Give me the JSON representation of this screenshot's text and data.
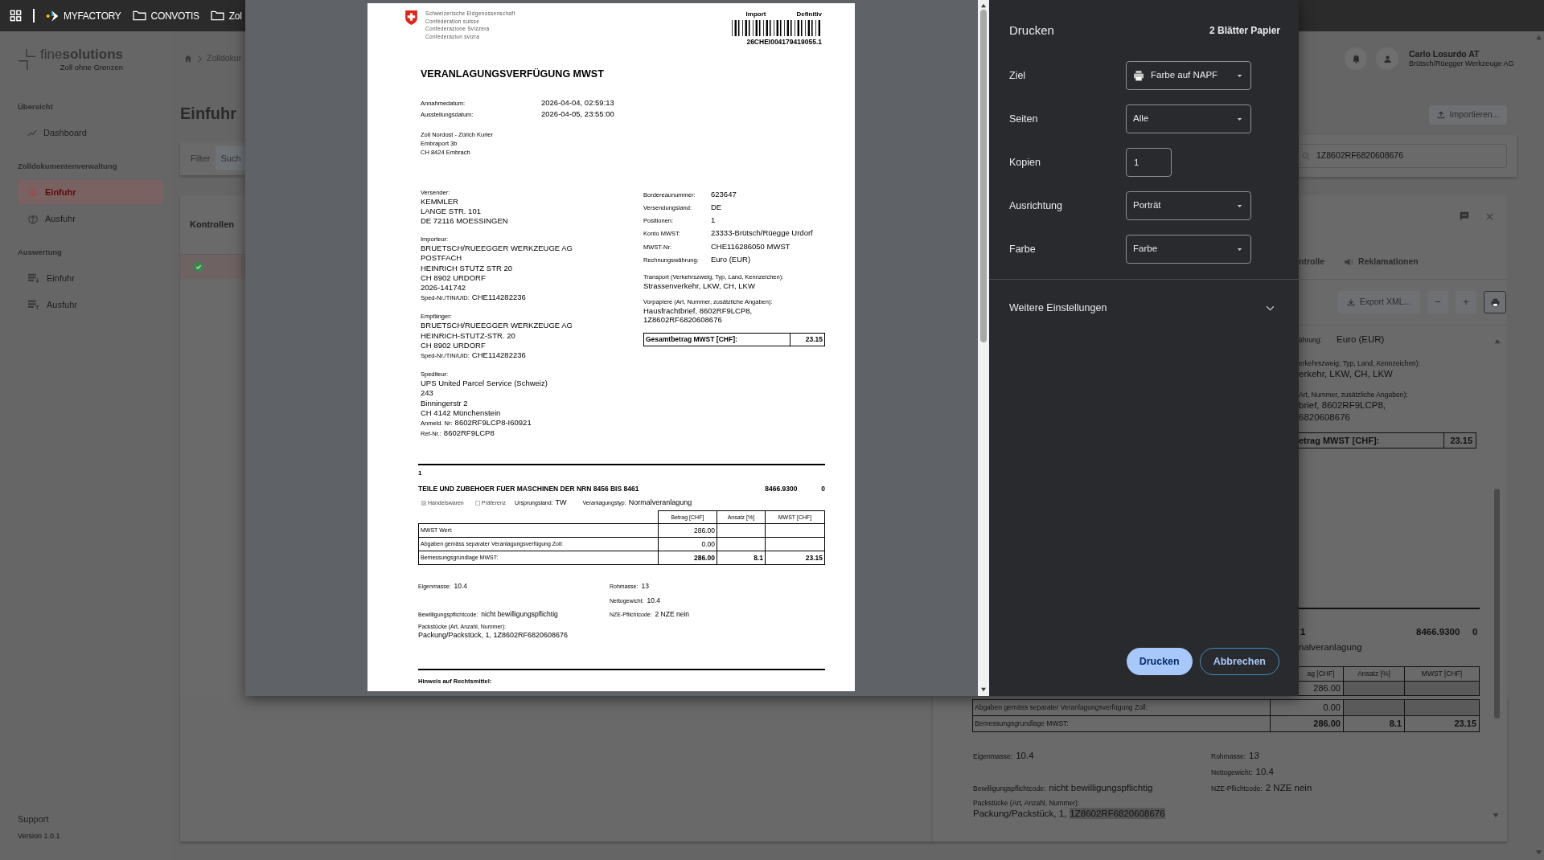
{
  "top_bar": {
    "items": [
      {
        "kind": "apps"
      },
      {
        "kind": "brand",
        "label": "MYFACTORY"
      },
      {
        "kind": "folder",
        "label": "CONVOTIS"
      },
      {
        "kind": "folder",
        "label": "Zol"
      }
    ]
  },
  "sidebar": {
    "logo": {
      "name": "fine**solutions**",
      "tagline": "Zoll ohne Grenzen"
    },
    "sections": [
      {
        "title": "Übersicht",
        "items": [
          {
            "label": "Dashboard",
            "selected": false
          }
        ]
      },
      {
        "title": "Zolldokumentenverwaltung",
        "items": [
          {
            "label": "Einfuhr",
            "selected": true
          },
          {
            "label": "Ausfuhr",
            "selected": false
          }
        ]
      },
      {
        "title": "Auswertung",
        "items": [
          {
            "label": "Einfuhr",
            "selected": false
          },
          {
            "label": "Ausfuhr",
            "selected": false
          }
        ]
      }
    ],
    "support": "Support",
    "version": "Version 1.0.1"
  },
  "main": {
    "breadcrumb": "Zolldokur",
    "title": "Einfuhr",
    "filter_tabs": [
      {
        "label": "Filter",
        "selected": false
      },
      {
        "label": "Such",
        "selected": true
      }
    ],
    "results_header": "Kontrollen"
  },
  "user": {
    "name": "Carlo Losurdo AT",
    "company": "Brütsch/Rüegger Werkzeuge AG"
  },
  "import_button": "Importieren...",
  "search": {
    "value": "1Z8602RF6820608676"
  },
  "detail": {
    "tabs": [
      {
        "label": "ntrolle"
      },
      {
        "label": "Reklamationen"
      }
    ],
    "toolbar": [
      {
        "kind": "export",
        "label": "Export XML...",
        "selected": false
      },
      {
        "kind": "zoom_out",
        "label": "−",
        "selected": false
      },
      {
        "kind": "zoom_in",
        "label": "+",
        "selected": false
      },
      {
        "kind": "print",
        "selected": true
      }
    ],
    "document_top": {
      "currency_label": "ährung:",
      "currency": "Euro (EUR)",
      "transport_label": "erkehrszweig, Typ, Land, Kennzeichen):",
      "transport": "erkehr, LKW, CH, LKW",
      "prior_label": "Art, Nummer, zusätzliche Angaben):",
      "prior_lines": [
        "brief, 8602RF9LCP8,",
        "6820608676"
      ],
      "total_label": "etrag MWST [CHF]:",
      "total": "23.15"
    },
    "item": {
      "number": "1",
      "tariff": "8466.9300",
      "column_3": "0",
      "assessment": "nalveranlagung",
      "columns": [
        "ag [CHF]",
        "Ansatz [%]",
        "MWST [CHF]"
      ],
      "rows": [
        {
          "kind": "plain",
          "amount": "286.00"
        },
        {
          "kind": "plain",
          "label": "Abgaben gemäss separater Veranlagungsverfügung Zoll:",
          "amount": "0.00"
        },
        {
          "kind": "total",
          "label": "Bemessungsgrundlage MWST:",
          "amount": "286.00",
          "rate": "8.1",
          "vat": "23.15"
        }
      ],
      "detail_rows": [
        {
          "left": {
            "label": "Eigenmasse:",
            "value": "10.4"
          },
          "right": {
            "label": "Rohmasse:",
            "value": "13"
          }
        },
        {
          "right": {
            "label": "Nettogewicht:",
            "value": "10.4"
          }
        },
        {
          "left": {
            "label": "Bewilligungspflichtcode:",
            "value": "nicht bewilligungspflichtig"
          },
          "right": {
            "label": "NZE-Pflichtcode:",
            "value": "2 NZE nein"
          }
        }
      ],
      "packages": {
        "label": "Packstücke (Art, Anzahl, Nummer):",
        "value": "Packung/Packstück, 1,",
        "highlighted": "1Z8602RF6820608676"
      }
    }
  },
  "print_dialog": {
    "title": "Drucken",
    "sheets": "2 Blätter Papier",
    "fields": [
      {
        "label": "Ziel",
        "kind": "select",
        "value": "Farbe auf NAPF"
      },
      {
        "label": "Seiten",
        "kind": "select",
        "value": "Alle"
      },
      {
        "label": "Kopien",
        "kind": "number",
        "value": "1"
      },
      {
        "label": "Ausrichtung",
        "kind": "select",
        "value": "Porträt"
      },
      {
        "label": "Farbe",
        "kind": "select",
        "value": "Farbe"
      }
    ],
    "more": "Weitere Einstellungen",
    "buttons": [
      {
        "label": "Drucken",
        "kind": "primary"
      },
      {
        "label": "Abbrechen",
        "kind": "secondary"
      }
    ]
  },
  "preview_page": {
    "authority": [
      "Schweizerische Eidgenossenschaft",
      "Confédération suisse",
      "Confederazione Svizzera",
      "Confederaziun svizra"
    ],
    "flow": "Import",
    "status": "Definitiv",
    "barcode_number": "26CHEI004179419055.1",
    "title": "VERANLAGUNGSVERFÜGUNG MWST",
    "dates": [
      {
        "label": "Annahmedatum:",
        "value": "2026-04-04, 02:59:13"
      },
      {
        "label": "Ausstellungsdatum:",
        "value": "2026-04-05, 23:55:00"
      }
    ],
    "office": [
      "Zoll Nordost - Zürich Kurier",
      "Embraport 3b",
      "CH 8424 Embrach"
    ],
    "parties": [
      {
        "label": "Versender:",
        "lines": [
          "KEMMLER",
          "LANGE STR. 101",
          "DE 72116 MOESSINGEN"
        ]
      },
      {
        "label": "Importeur:",
        "lines": [
          "BRUETSCH/RUEEGGER WERKZEUGE AG",
          "POSTFACH",
          "HEINRICH STUTZ STR 20",
          "CH 8902 URDORF",
          "2026-141742"
        ],
        "refs": [
          {
            "label": "Sped-Nr./TIN/UID:",
            "value": "CHE114282236"
          }
        ]
      },
      {
        "label": "Empfänger:",
        "lines": [
          "BRUETSCH/RUEEGGER WERKZEUGE AG",
          "HEINRICH-STUTZ-STR. 20",
          "CH 8902 URDORF"
        ],
        "refs": [
          {
            "label": "Sped-Nr./TIN/UID:",
            "value": "CHE114282236"
          }
        ]
      },
      {
        "label": "Spediteur:",
        "lines": [
          "UPS United Parcel Service (Schweiz)",
          "243",
          "Binningerstr 2",
          "CH 4142 Münchenstein"
        ],
        "refs": [
          {
            "label": "Anmeld. Nr:",
            "value": "8602RF9LCP8-I60921"
          },
          {
            "label": "Ref-Nr.:",
            "value": "8602RF9LCP8"
          }
        ]
      }
    ],
    "facts": [
      {
        "label": "Bordereaunummer:",
        "value": "623647"
      },
      {
        "label": "Versendungsland:",
        "value": "DE"
      },
      {
        "label": "Positionen:",
        "value": "1"
      },
      {
        "label": "Konto MWST:",
        "value": "23333-Brütsch/Rüegge Urdorf"
      },
      {
        "label": "MWST-Nr:",
        "value": "CHE116286050 MWST"
      },
      {
        "label": "Rechnungswährung:",
        "value": "Euro (EUR)"
      }
    ],
    "notes": [
      {
        "label": "Transport (Verkehrszweig, Typ, Land, Kennzeichen):",
        "lines": [
          "Strassenverkehr, LKW, CH, LKW"
        ]
      },
      {
        "label": "Vorpapiere (Art, Nummer, zusätzliche Angaben):",
        "lines": [
          "Hausfrachtbrief, 8602RF9LCP8,",
          "1Z8602RF6820608676"
        ]
      }
    ],
    "total": {
      "label": "Gesamtbetrag MWST [CHF]:",
      "value": "23.15"
    },
    "item": {
      "number": "1",
      "description": "TEILE UND ZUBEHOER FUER MASCHINEN DER NRN 8456 BIS 8461",
      "tariff": "8466.9300",
      "column_3": "0",
      "flags": [
        {
          "label": "Handelswaren",
          "checked": true
        },
        {
          "label": "Präferenz",
          "checked": false
        }
      ],
      "origin": {
        "label": "Ursprungsland:",
        "value": "TW"
      },
      "assessment": {
        "label": "Veranlagungstyp:",
        "value": "Normalveranlagung"
      },
      "columns": [
        "Betrag [CHF]",
        "Ansatz [%]",
        "MWST [CHF]"
      ],
      "rows": [
        {
          "kind": "plain",
          "label": "MWST Wert:",
          "amount": "286.00"
        },
        {
          "kind": "plain",
          "label": "Abgaben gemäss separater Veranlagungsverfügung Zoll:",
          "amount": "0.00"
        },
        {
          "kind": "total",
          "label": "Bemessungsgrundlage MWST:",
          "amount": "286.00",
          "rate": "8.1",
          "vat": "23.15"
        }
      ],
      "detail_rows": [
        {
          "left": {
            "label": "Eigenmasse:",
            "value": "10.4"
          },
          "right": {
            "label": "Rohmasse:",
            "value": "13"
          }
        },
        {
          "right": {
            "label": "Nettogewicht:",
            "value": "10.4"
          }
        },
        {
          "left": {
            "label": "Bewilligungspflichtcode:",
            "value": "nicht bewilligungspflichtig"
          },
          "right": {
            "label": "NZE-Pflichtcode:",
            "value": "2 NZE nein"
          }
        }
      ],
      "packages": {
        "label": "Packstücke (Art, Anzahl, Nummer):",
        "value": "Packung/Packstück, 1, 1Z8602RF6820608676"
      }
    },
    "footer_heading": "Hinweis auf Rechtsmittel:"
  }
}
